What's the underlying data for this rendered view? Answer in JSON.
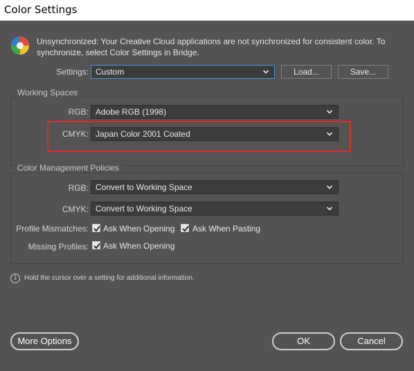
{
  "window": {
    "title": "Color Settings"
  },
  "notice": {
    "text": "Unsynchronized: Your Creative Cloud applications are not synchronized for consistent color. To synchronize, select Color Settings in Bridge."
  },
  "settings": {
    "label": "Settings:",
    "value": "Custom",
    "load_label": "Load...",
    "save_label": "Save..."
  },
  "working_spaces": {
    "title": "Working Spaces",
    "rgb": {
      "label": "RGB:",
      "value": "Adobe RGB (1998)"
    },
    "cmyk": {
      "label": "CMYK:",
      "value": "Japan Color 2001 Coated"
    }
  },
  "policies": {
    "title": "Color Management Policies",
    "rgb": {
      "label": "RGB:",
      "value": "Convert to Working Space"
    },
    "cmyk": {
      "label": "CMYK:",
      "value": "Convert to Working Space"
    },
    "profile_mismatches": {
      "label": "Profile Mismatches:",
      "ask_opening": "Ask When Opening",
      "ask_opening_checked": true,
      "ask_pasting": "Ask When Pasting",
      "ask_pasting_checked": true
    },
    "missing_profiles": {
      "label": "Missing Profiles:",
      "ask_opening": "Ask When Opening",
      "ask_opening_checked": true
    }
  },
  "info": {
    "text": "Hold the cursor over a setting for additional information."
  },
  "footer": {
    "more_options_label": "More Options",
    "ok_label": "OK",
    "cancel_label": "Cancel"
  },
  "colors": {
    "highlight": "#e02a2a",
    "focus": "#4c8de8",
    "background": "#535353"
  }
}
